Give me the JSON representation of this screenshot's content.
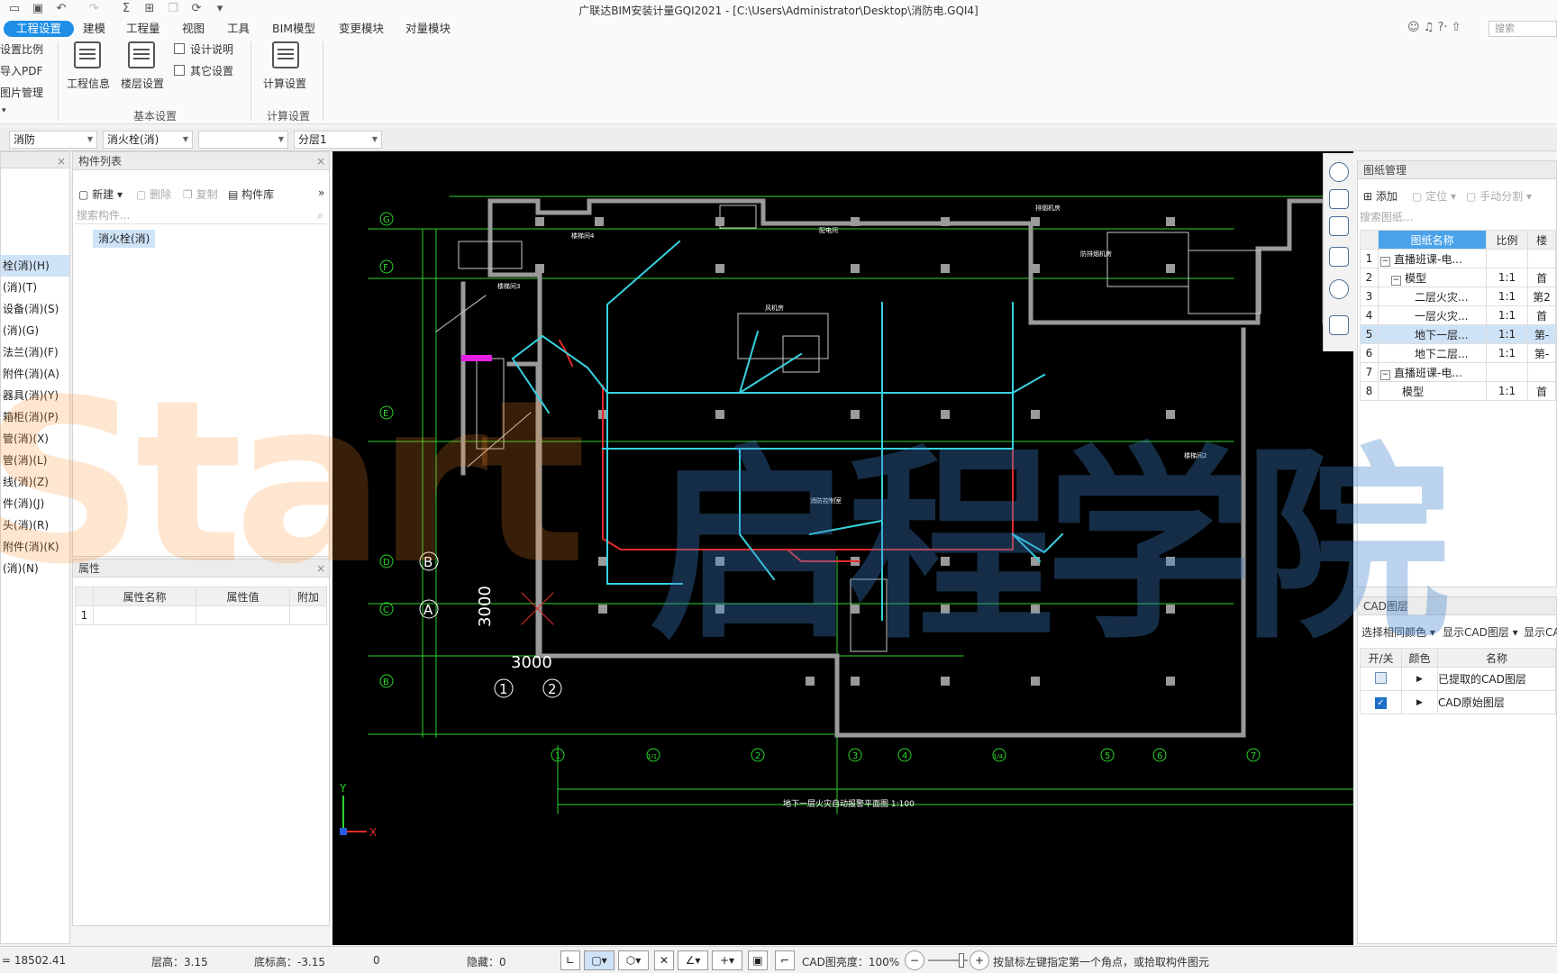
{
  "window": {
    "title": "广联达BIM安装计量GQI2021 - [C:\\Users\\Administrator\\Desktop\\消防电.GQI4]",
    "search_placeholder": "搜索"
  },
  "menu": [
    "工程设置",
    "建模",
    "工程量",
    "视图",
    "工具",
    "BIM模型",
    "变更模块",
    "对量模块"
  ],
  "ribbon": {
    "left_items": [
      "设置比例",
      "导入PDF",
      "图片管理"
    ],
    "engineering_info": "工程信息",
    "floor_settings": "楼层设置",
    "design_notes": "设计说明",
    "other_settings": "其它设置",
    "group_basic": "基本设置",
    "calc_settings": "计算设置",
    "group_calc": "计算设置"
  },
  "filters": {
    "discipline": "消防",
    "category": "消火栓(消)",
    "blank": "",
    "layer": "分层1"
  },
  "nav_tree": {
    "items": [
      "栓(消)(H)",
      "(消)(T)",
      "设备(消)(S)",
      "(消)(G)",
      "法兰(消)(F)",
      "附件(消)(A)",
      "器具(消)(Y)",
      "箱柜(消)(P)",
      "管(消)(X)",
      "管(消)(L)",
      "线(消)(Z)",
      "件(消)(J)",
      "头(消)(R)",
      "附件(消)(K)",
      "(消)(N)"
    ],
    "selected_index": 0
  },
  "component_list": {
    "title": "构件列表",
    "new": "新建",
    "delete": "删除",
    "copy": "复制",
    "library": "构件库",
    "search_placeholder": "搜索构件...",
    "items": [
      "消火栓(消)"
    ]
  },
  "properties": {
    "title": "属性",
    "col_name": "属性名称",
    "col_value": "属性值",
    "col_extra": "附加",
    "row1": "1"
  },
  "cad_text": {
    "axis_rows": [
      "G",
      "F",
      "E",
      "D",
      "C",
      "B"
    ],
    "axis_cols": [
      "1",
      "1/1",
      "2",
      "3",
      "4",
      "1/4",
      "5",
      "6",
      "7"
    ],
    "big_dim": "3000",
    "big_dim_vertical": "3000",
    "local_b": "B",
    "local_a": "A",
    "local_1": "1",
    "local_2": "2",
    "drawing_title": "地下一层火灾自动报警平面图  1:100",
    "room_labels": [
      "楼梯间4",
      "楼梯间3",
      "配电间",
      "风机房",
      "消防控制室",
      "楼梯间2",
      "排烟机房",
      "防排烟机房"
    ],
    "ucs_x": "X",
    "ucs_y": "Y"
  },
  "drawing_mgmt": {
    "title": "图纸管理",
    "add": "添加",
    "locate": "定位",
    "split": "手动分割",
    "search_placeholder": "搜索图纸...",
    "col_name": "图纸名称",
    "col_scale": "比例",
    "col_floor": "楼",
    "rows": [
      {
        "no": "1",
        "toggle": "−",
        "name": "直播班课-电...",
        "scale": "",
        "floor": ""
      },
      {
        "no": "2",
        "toggle": "−",
        "name": "模型",
        "scale": "1:1",
        "floor": "首"
      },
      {
        "no": "3",
        "toggle": "",
        "name": "二层火灾...",
        "scale": "1:1",
        "floor": "第2"
      },
      {
        "no": "4",
        "toggle": "",
        "name": "一层火灾...",
        "scale": "1:1",
        "floor": "首"
      },
      {
        "no": "5",
        "toggle": "",
        "name": "地下一层...",
        "scale": "1:1",
        "floor": "第-"
      },
      {
        "no": "6",
        "toggle": "",
        "name": "地下二层...",
        "scale": "1:1",
        "floor": "第-"
      },
      {
        "no": "7",
        "toggle": "−",
        "name": "直播班课-电...",
        "scale": "",
        "floor": ""
      },
      {
        "no": "8",
        "toggle": "",
        "name": "模型",
        "scale": "1:1",
        "floor": "首"
      }
    ],
    "selected_row": 4
  },
  "cad_layers": {
    "title": "CAD图层",
    "same_color": "选择相同颜色",
    "show_cad": "显示CAD图层",
    "show_cad2": "显示CA",
    "col_toggle": "开/关",
    "col_color": "颜色",
    "col_name": "名称",
    "rows": [
      {
        "name": "已提取的CAD图层",
        "checked": false
      },
      {
        "name": "CAD原始图层",
        "checked": true
      }
    ]
  },
  "status": {
    "coord": "= 18502.41",
    "floor_height": "层高：3.15",
    "bottom_elev": "底标高：-3.15",
    "zero": "0",
    "hidden": "隐藏：0",
    "cad_brightness": "CAD图亮度：100%",
    "hint": "按鼠标左键指定第一个角点，或拾取构件图元"
  },
  "watermark": {
    "latin": "Start",
    "cjk": "启程学院"
  }
}
